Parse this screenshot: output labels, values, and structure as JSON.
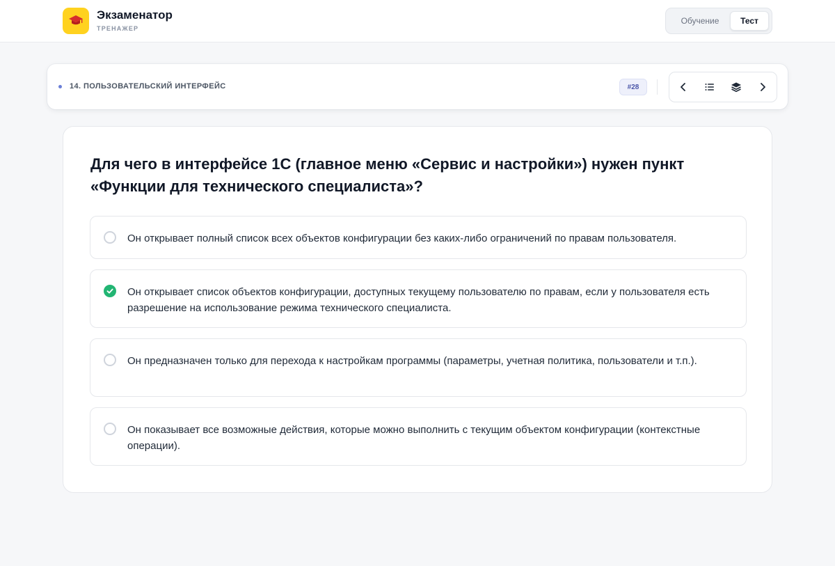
{
  "header": {
    "app_title": "Экзаменатор",
    "app_subtitle": "ТРЕНАЖЕР",
    "logo_icon": "graduation-cap-icon",
    "modes": [
      {
        "label": "Обучение",
        "active": false
      },
      {
        "label": "Тест",
        "active": true
      }
    ]
  },
  "topic_bar": {
    "topic": "14. ПОЛЬЗОВАТЕЛЬСКИЙ ИНТЕРФЕЙС",
    "question_number": "#28",
    "nav_icons": [
      "chevron-left-icon",
      "list-icon",
      "layers-icon",
      "chevron-right-icon"
    ]
  },
  "question": {
    "text": "Для чего в интерфейсе 1С (главное меню «Сервис и настройки») нужен пункт «Функции для технического специалиста»?",
    "options": [
      {
        "text": "Он открывает полный список всех объектов конфигурации без каких-либо ограничений по правам пользователя.",
        "selected": false
      },
      {
        "text": "Он открывает список объектов конфигурации, доступных текущему пользователю по правам, если у пользователя есть разрешение на использование режима технического специалиста.",
        "selected": true
      },
      {
        "text": "Он предназначен только для перехода к настройкам программы (параметры, учетная политика, пользователи и т.п.).",
        "selected": false
      },
      {
        "text": "Он показывает все возможные действия, которые можно выполнить с текущим объектом конфигурации (контекстные операции).",
        "selected": false
      }
    ]
  },
  "colors": {
    "brand": "#ffd21f",
    "accent": "#4b56a8",
    "correct": "#22b573"
  }
}
